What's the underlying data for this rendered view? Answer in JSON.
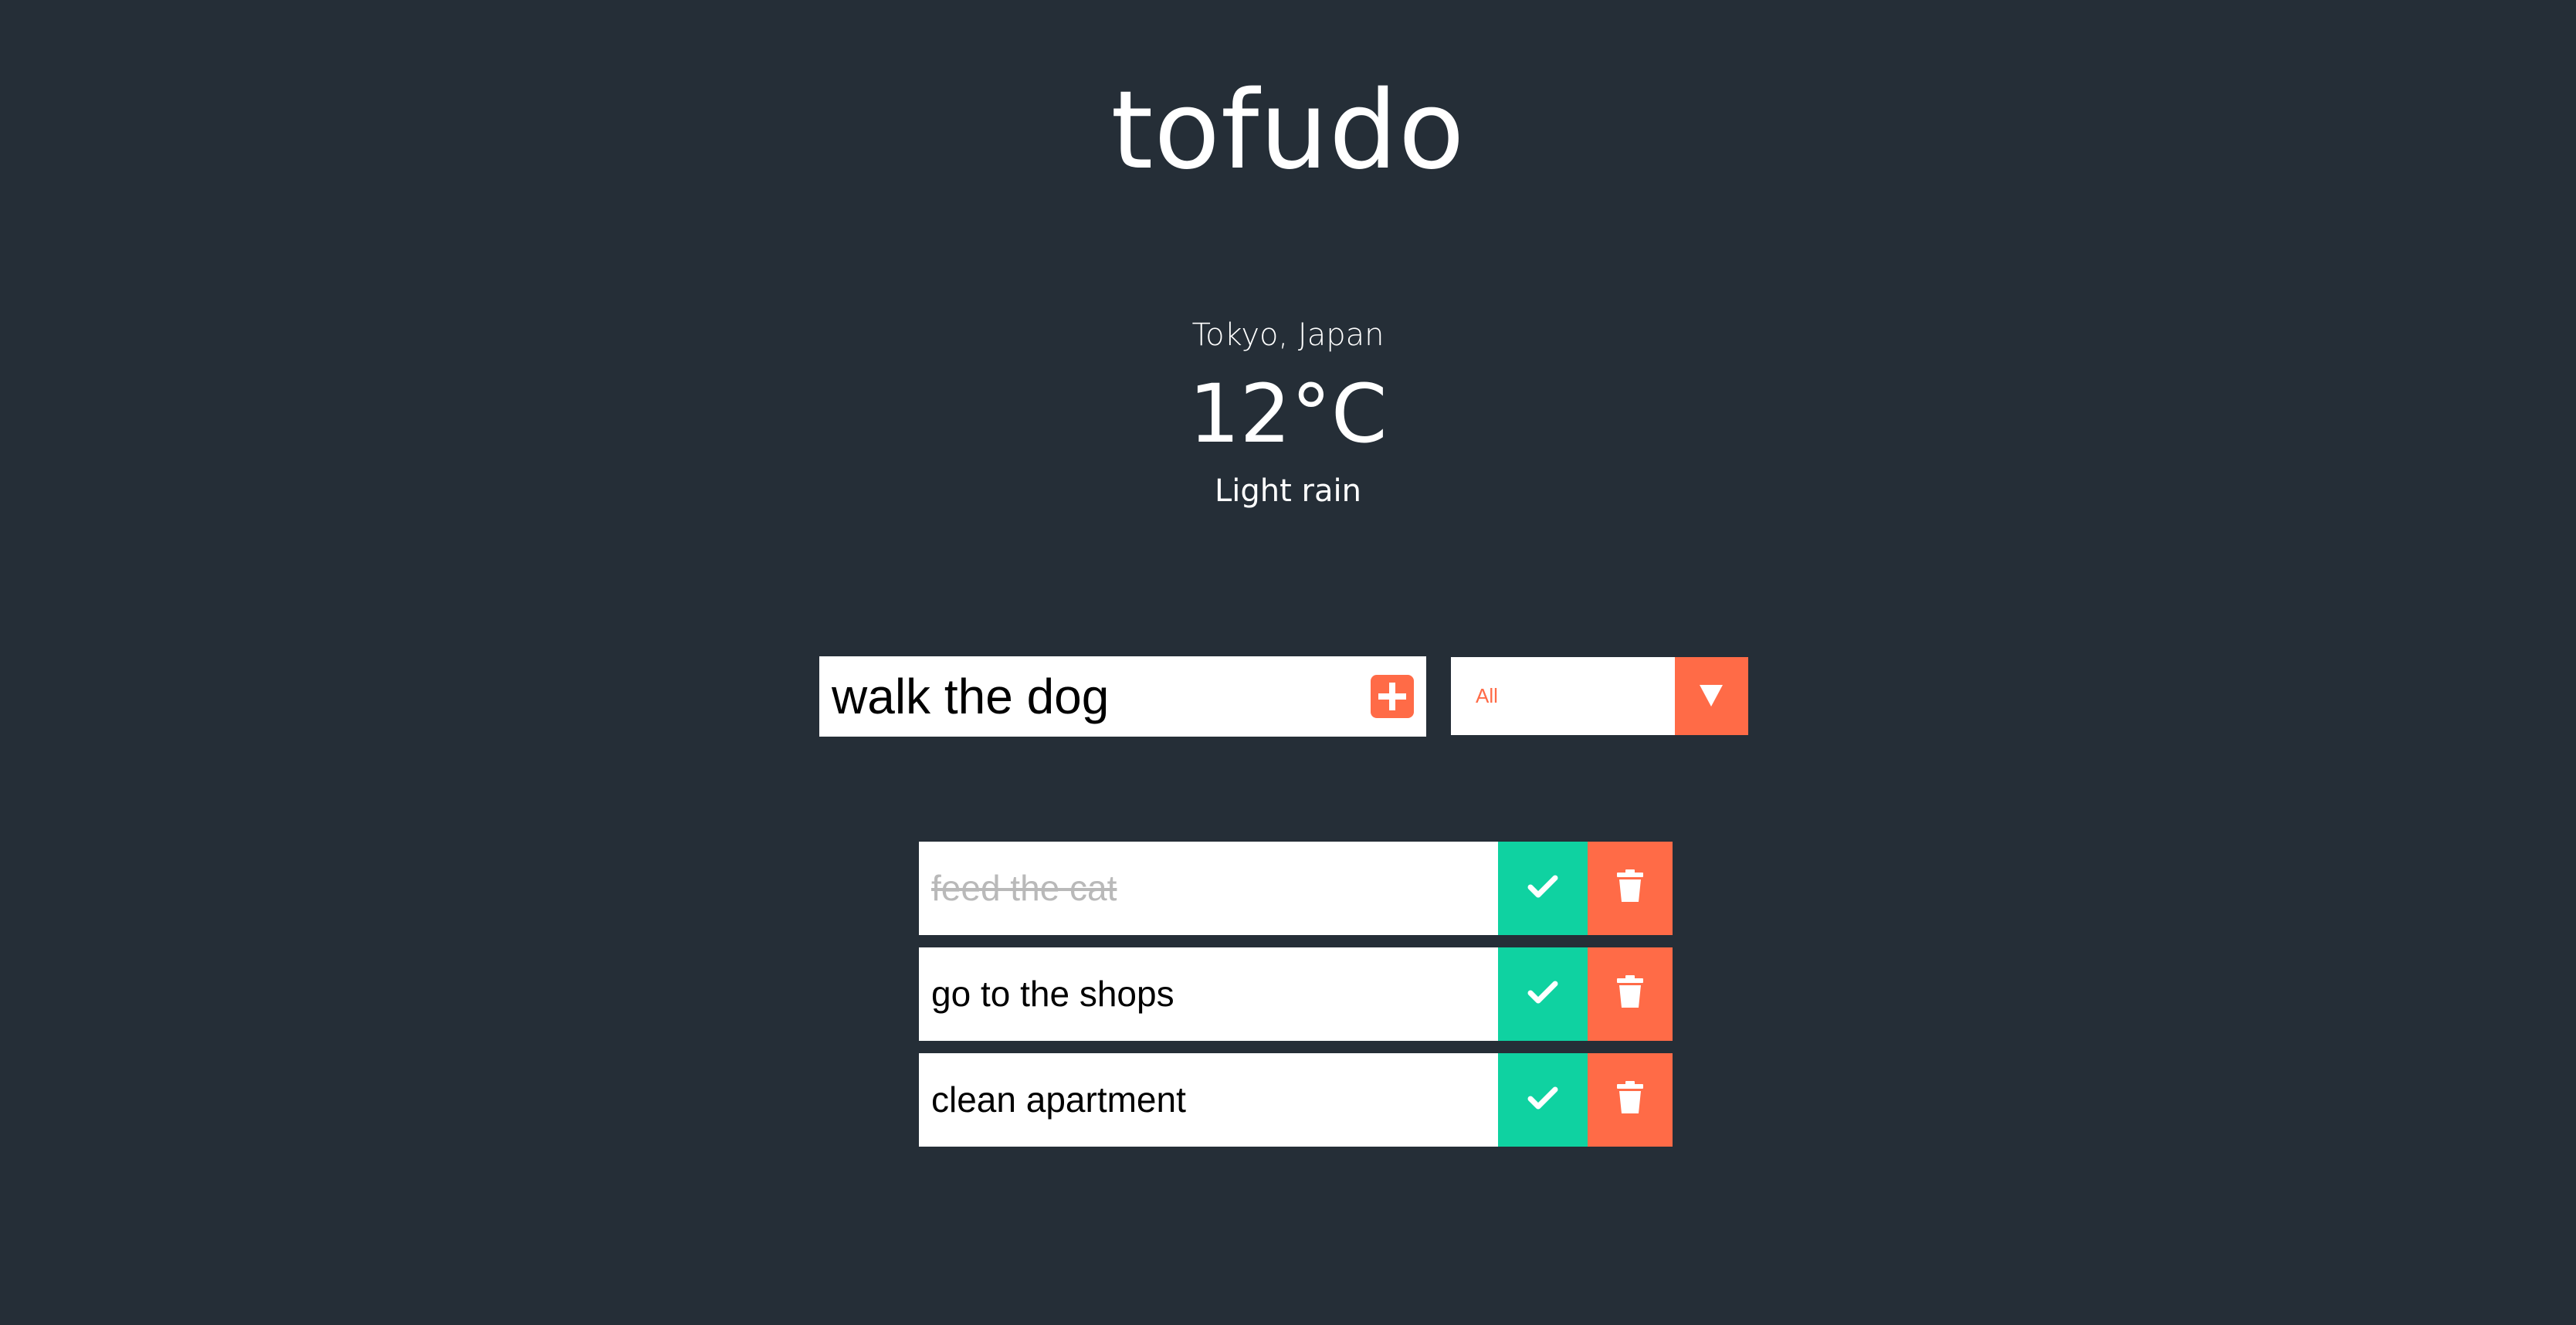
{
  "app": {
    "title": "tofudo"
  },
  "weather": {
    "location": "Tokyo, Japan",
    "temperature": "12°C",
    "description": "Light rain"
  },
  "form": {
    "input_value": "walk the dog",
    "add_icon": "plus-square-icon",
    "filter_selected": "All",
    "filter_icon": "triangle-down-icon"
  },
  "todos": [
    {
      "text": "feed the cat",
      "completed": true
    },
    {
      "text": "go to the shops",
      "completed": false
    },
    {
      "text": "clean apartment",
      "completed": false
    }
  ],
  "colors": {
    "background": "#252e37",
    "accent": "#ff6b47",
    "check": "#0fd2a1",
    "completed_text": "#b9b9b9"
  }
}
